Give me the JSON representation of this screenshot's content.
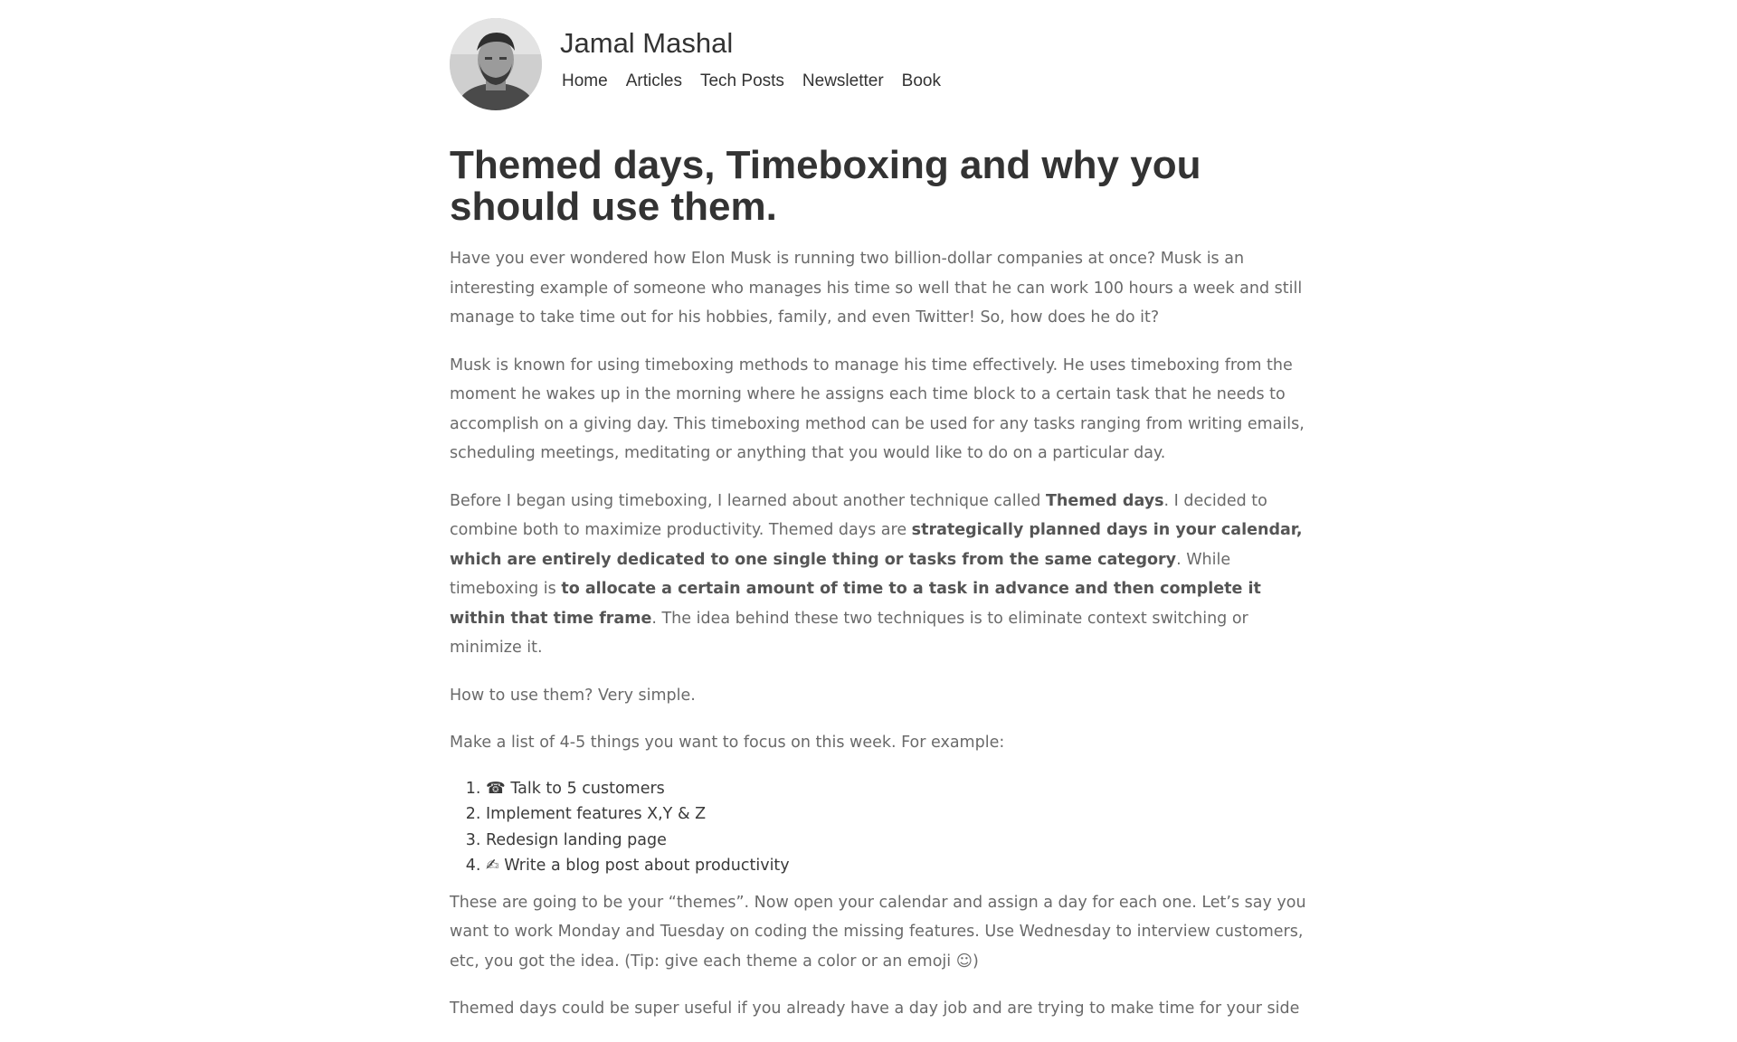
{
  "site": {
    "author_name": "Jamal Mashal",
    "nav": [
      "Home",
      "Articles",
      "Tech Posts",
      "Newsletter",
      "Book"
    ]
  },
  "post": {
    "title": "Themed days, Timeboxing and why you should use them.",
    "p1": "Have you ever wondered how Elon Musk is running two billion-dollar companies at once? Musk is an interesting example of someone who manages his time so well that he can work 100 hours a week and still manage to take time out for his hobbies, family, and even Twitter! So, how does he do it?",
    "p2": "Musk is known for using timeboxing methods to manage his time effectively. He uses timeboxing from the moment he wakes up in the morning where he assigns each time block to a certain task that he needs to accomplish on a giving day. This timeboxing method can be used for any tasks ranging from writing emails, scheduling meetings, meditating or anything that you would like to do on a particular day.",
    "p3": {
      "t1": "Before I began using timeboxing, I learned about another technique called ",
      "b1": "Themed days",
      "t2": ". I decided to combine both to maximize productivity. Themed days are ",
      "b2": "strategically planned days in your calendar, which are entirely dedicated to one single thing or tasks from the same category",
      "t3": ". While timeboxing is ",
      "b3": "to allocate a certain amount of time to a task in advance and then complete it within that time frame",
      "t4": ". The idea behind these two techniques is to eliminate context switching or minimize it."
    },
    "p4": "How to use them? Very simple.",
    "p5": "Make a list of 4-5 things you want to focus on this week. For example:",
    "list": [
      "☎ Talk to 5 customers",
      "  Implement features X,Y & Z",
      "  Redesign landing page",
      "✍ Write a blog post about productivity"
    ],
    "p6": "These are going to be your “themes”. Now open your calendar and assign a day for each one. Let’s say you want to work Monday and Tuesday on coding the missing features. Use Wednesday to interview customers, etc, you got the idea. (Tip: give each theme a color or an emoji ☺)",
    "p7": "Themed days could be super useful if you already have a day job and are trying to make time for your side"
  }
}
